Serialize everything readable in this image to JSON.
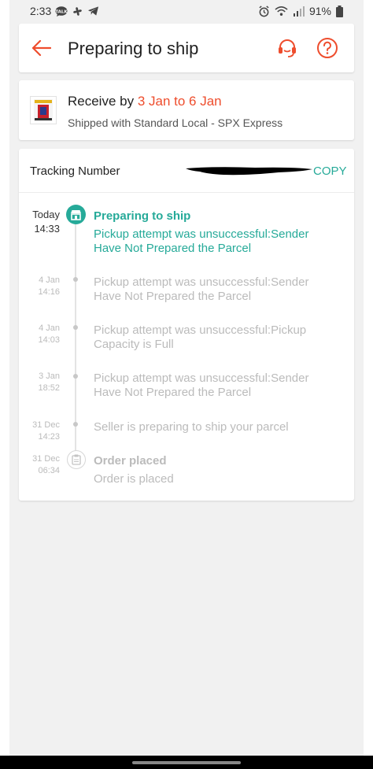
{
  "status_bar": {
    "time": "2:33",
    "battery": "91%",
    "left_icons": [
      "talk-icon",
      "pinwheel-icon",
      "telegram-icon"
    ],
    "right_icons": [
      "alarm-icon",
      "wifi-icon",
      "signal-icon",
      "battery-icon"
    ]
  },
  "header": {
    "title": "Preparing to ship",
    "back_icon": "arrow-left-icon",
    "support_icon": "headset-icon",
    "help_icon": "question-circle-icon"
  },
  "delivery": {
    "receive_prefix": "Receive by ",
    "receive_dates": "3 Jan to 6 Jan",
    "shipped_with": "Shipped with Standard Local - SPX Express"
  },
  "tracking": {
    "label": "Tracking Number",
    "copy_label": "COPY",
    "current": {
      "day": "Today",
      "time": "14:33",
      "title": "Preparing to ship",
      "line1": "Pickup attempt was unsuccessful:Sender",
      "line2": "Have Not Prepared the Parcel"
    },
    "events": [
      {
        "day": "4 Jan",
        "time": "14:16",
        "line1": "Pickup attempt was unsuccessful:Sender",
        "line2": "Have Not Prepared the Parcel"
      },
      {
        "day": "4 Jan",
        "time": "14:03",
        "line1": "Pickup attempt was unsuccessful:Pickup",
        "line2": "Capacity is Full"
      },
      {
        "day": "3 Jan",
        "time": "18:52",
        "line1": "Pickup attempt was unsuccessful:Sender",
        "line2": "Have Not Prepared the Parcel"
      },
      {
        "day": "31 Dec",
        "time": "14:23",
        "line1": "Seller is preparing to ship your parcel"
      }
    ],
    "placed": {
      "day": "31 Dec",
      "time": "06:34",
      "title": "Order placed",
      "line1": "Order is placed"
    }
  },
  "colors": {
    "brand": "#ee4d2d",
    "teal": "#26aa99",
    "muted": "#bbbbbb"
  }
}
